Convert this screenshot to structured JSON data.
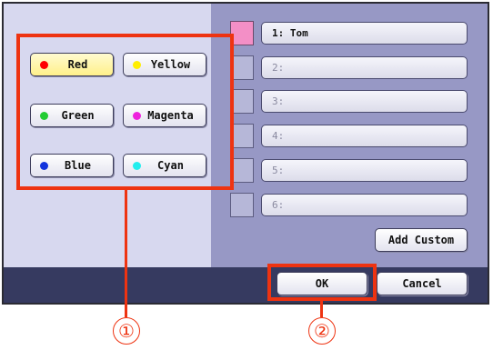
{
  "colors": [
    {
      "label": "Red",
      "dot": "#ff0000",
      "selected": true
    },
    {
      "label": "Yellow",
      "dot": "#ffee00",
      "selected": false
    },
    {
      "label": "Green",
      "dot": "#22cc33",
      "selected": false
    },
    {
      "label": "Magenta",
      "dot": "#ee22dd",
      "selected": false
    },
    {
      "label": "Blue",
      "dot": "#1133dd",
      "selected": false
    },
    {
      "label": "Cyan",
      "dot": "#22eeee",
      "selected": false
    }
  ],
  "entries": [
    {
      "label": "1: Tom",
      "swatch": "#f38fc6"
    },
    {
      "label": "2:",
      "swatch": ""
    },
    {
      "label": "3:",
      "swatch": ""
    },
    {
      "label": "4:",
      "swatch": ""
    },
    {
      "label": "5:",
      "swatch": ""
    },
    {
      "label": "6:",
      "swatch": ""
    }
  ],
  "buttons": {
    "add_custom": "Add Custom",
    "ok": "OK",
    "cancel": "Cancel"
  },
  "callouts": {
    "one": "①",
    "two": "②"
  },
  "theme": {
    "accent": "#ee3311",
    "bottom_bar": "#363a60"
  }
}
